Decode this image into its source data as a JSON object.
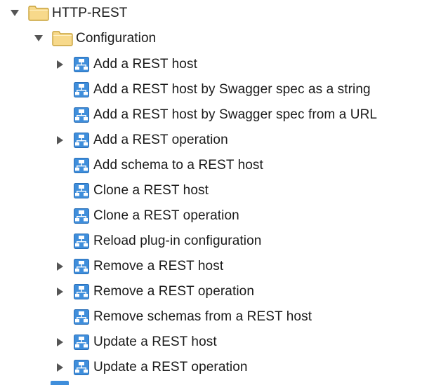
{
  "tree": {
    "root": {
      "label": "HTTP-REST",
      "expanded": true,
      "icon": "folder-icon"
    },
    "folder": {
      "label": "Configuration",
      "expanded": true,
      "icon": "folder-icon"
    },
    "workflows": [
      {
        "label": "Add a REST host",
        "has_children": true
      },
      {
        "label": "Add a REST host by Swagger spec as a string",
        "has_children": false
      },
      {
        "label": "Add a REST host by Swagger spec from a URL",
        "has_children": false
      },
      {
        "label": "Add a REST operation",
        "has_children": true
      },
      {
        "label": "Add schema to a REST host",
        "has_children": false
      },
      {
        "label": "Clone a REST host",
        "has_children": false
      },
      {
        "label": "Clone a REST operation",
        "has_children": false
      },
      {
        "label": "Reload plug-in configuration",
        "has_children": false
      },
      {
        "label": "Remove a REST host",
        "has_children": true
      },
      {
        "label": "Remove a REST operation",
        "has_children": true
      },
      {
        "label": "Remove schemas from a REST host",
        "has_children": false
      },
      {
        "label": "Update a REST host",
        "has_children": true
      },
      {
        "label": "Update a REST operation",
        "has_children": true
      }
    ],
    "workflow_icon": "workflow-icon",
    "colors": {
      "folder_fill": "#f7d98b",
      "folder_stroke": "#c9a23a",
      "workflow_blue": "#3f8edb",
      "twisty": "#555555",
      "text": "#1a1a1a"
    }
  }
}
